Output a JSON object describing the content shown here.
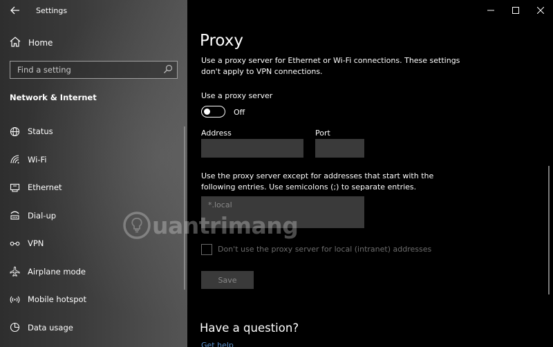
{
  "window": {
    "title": "Settings"
  },
  "sidebar": {
    "home_label": "Home",
    "search_placeholder": "Find a setting",
    "section_title": "Network & Internet",
    "items": [
      {
        "label": "Status",
        "icon": "globe-icon"
      },
      {
        "label": "Wi-Fi",
        "icon": "wifi-icon"
      },
      {
        "label": "Ethernet",
        "icon": "ethernet-icon"
      },
      {
        "label": "Dial-up",
        "icon": "dialup-icon"
      },
      {
        "label": "VPN",
        "icon": "vpn-icon"
      },
      {
        "label": "Airplane mode",
        "icon": "airplane-icon"
      },
      {
        "label": "Mobile hotspot",
        "icon": "hotspot-icon"
      },
      {
        "label": "Data usage",
        "icon": "data-usage-icon"
      }
    ]
  },
  "main": {
    "title": "Proxy",
    "description": "Use a proxy server for Ethernet or Wi-Fi connections. These settings don't apply to VPN connections.",
    "use_proxy_label": "Use a proxy server",
    "toggle_state": "Off",
    "address_label": "Address",
    "address_value": "",
    "port_label": "Port",
    "port_value": "",
    "exceptions_label": "Use the proxy server except for addresses that start with the following entries. Use semicolons (;) to separate entries.",
    "exceptions_placeholder": "*.local",
    "local_checkbox_label": "Don't use the proxy server for local (intranet) addresses",
    "save_label": "Save",
    "question_title": "Have a question?",
    "get_help_link": "Get help"
  },
  "watermark": {
    "text": "uantrimang"
  },
  "colors": {
    "accent_link": "#5a8fcb",
    "field_bg": "#3a3a3a",
    "main_bg": "#000000"
  }
}
